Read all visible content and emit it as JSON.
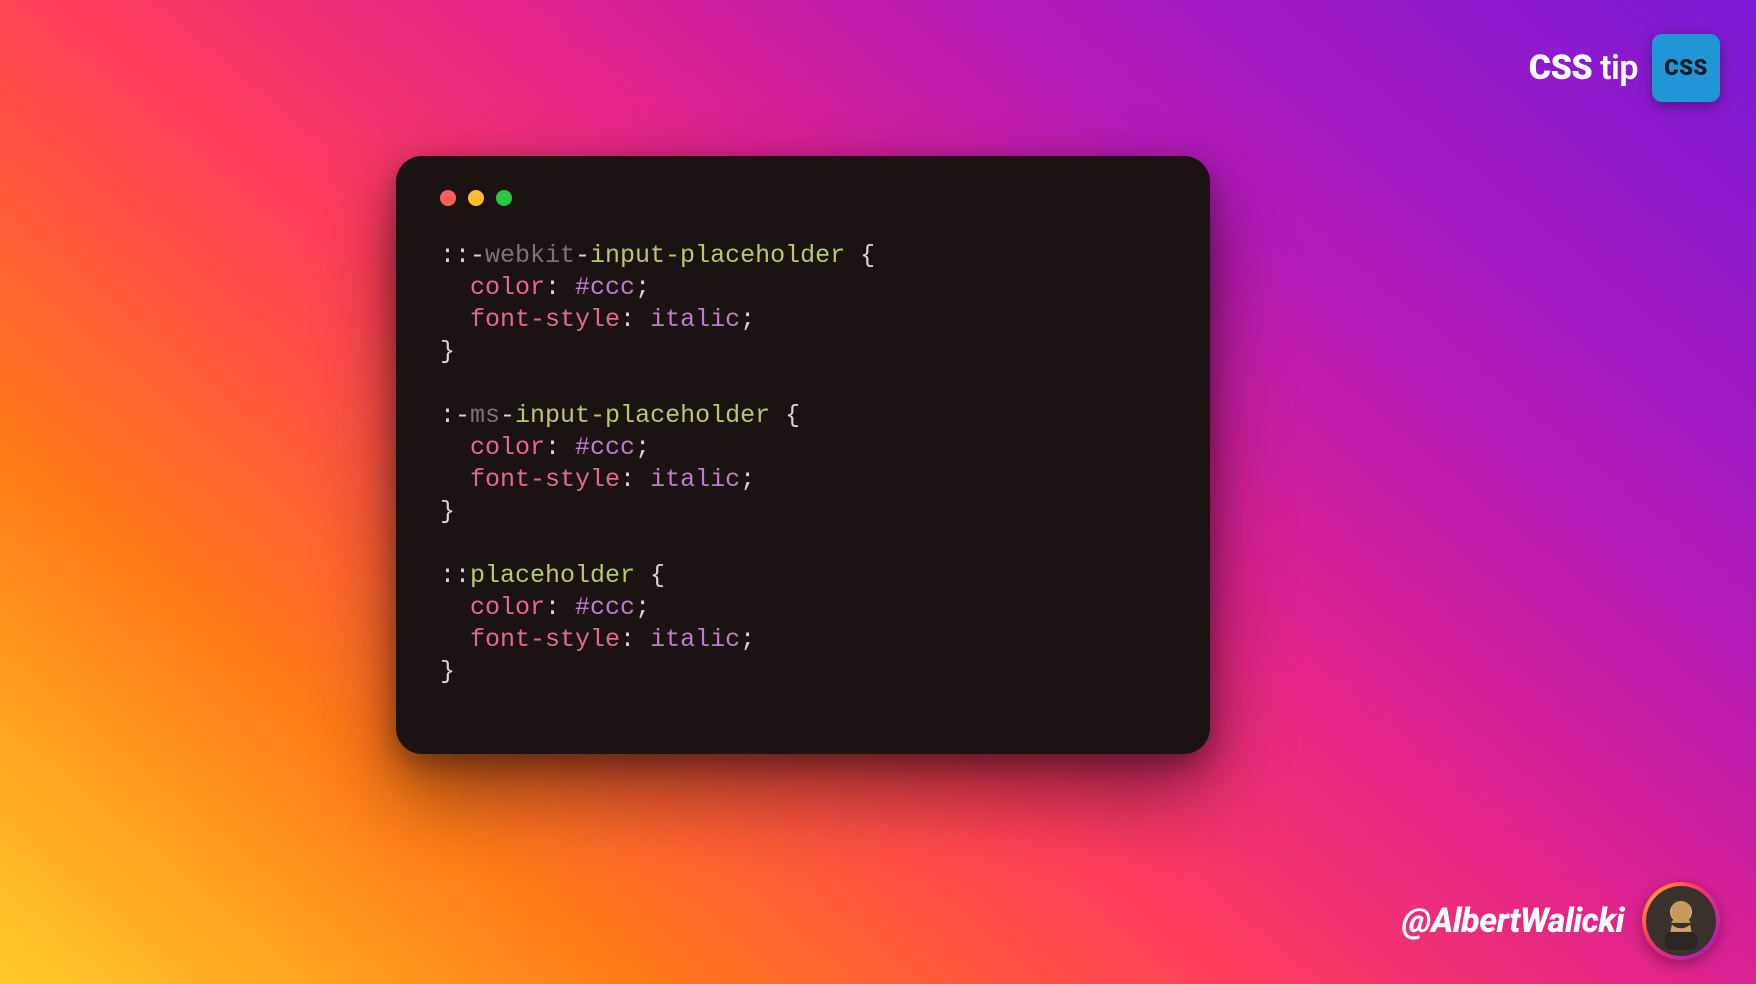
{
  "header": {
    "tip_label_bold": "CSS",
    "tip_label_light": " tip",
    "badge_text": "CSS"
  },
  "window": {
    "traffic": [
      "red",
      "yellow",
      "green"
    ]
  },
  "code": {
    "blocks": [
      {
        "selector_vendor": "webkit",
        "selector_suffix": "input-placeholder",
        "selector_prefix": "::-",
        "rules": [
          {
            "prop": "color",
            "val": "#ccc"
          },
          {
            "prop": "font-style",
            "val": "italic"
          }
        ]
      },
      {
        "selector_vendor": "ms",
        "selector_suffix": "input-placeholder",
        "selector_prefix": ":-",
        "rules": [
          {
            "prop": "color",
            "val": "#ccc"
          },
          {
            "prop": "font-style",
            "val": "italic"
          }
        ]
      },
      {
        "selector_vendor": "",
        "selector_suffix": "placeholder",
        "selector_prefix": "::",
        "rules": [
          {
            "prop": "color",
            "val": "#ccc"
          },
          {
            "prop": "font-style",
            "val": "italic"
          }
        ]
      }
    ]
  },
  "footer": {
    "handle": "@AlbertWalicki"
  },
  "colors": {
    "window_bg": "#1a1312",
    "badge_bg": "#2196d6"
  }
}
